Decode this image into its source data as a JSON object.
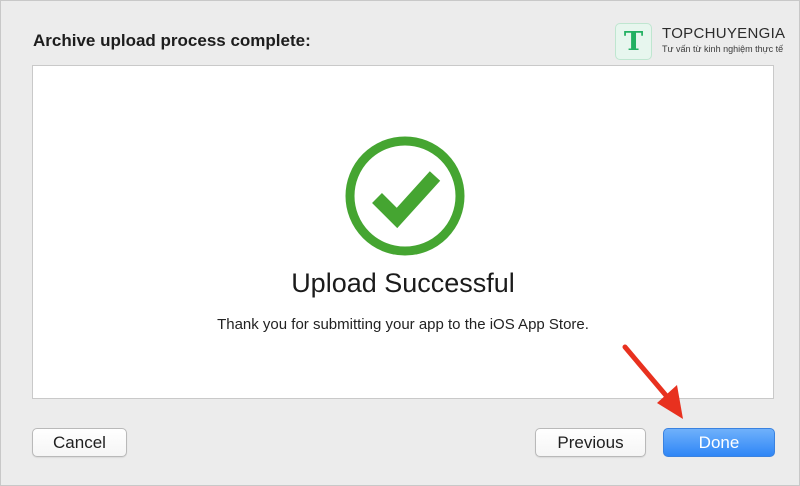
{
  "dialog": {
    "title": "Archive upload process complete:",
    "heading": "Upload Successful",
    "message": "Thank you for submitting your app to the iOS App Store.",
    "status_icon": "checkmark-circle-icon",
    "status_color": "#45a531"
  },
  "buttons": {
    "cancel_label": "Cancel",
    "previous_label": "Previous",
    "done_label": "Done"
  },
  "annotation": {
    "arrow_color": "#e8311f"
  },
  "watermark": {
    "logo_letter": "T",
    "name": "TOPCHUYENGIA",
    "tagline": "Tư vấn từ kinh nghiệm thực tế",
    "brand_color": "#22b061"
  }
}
